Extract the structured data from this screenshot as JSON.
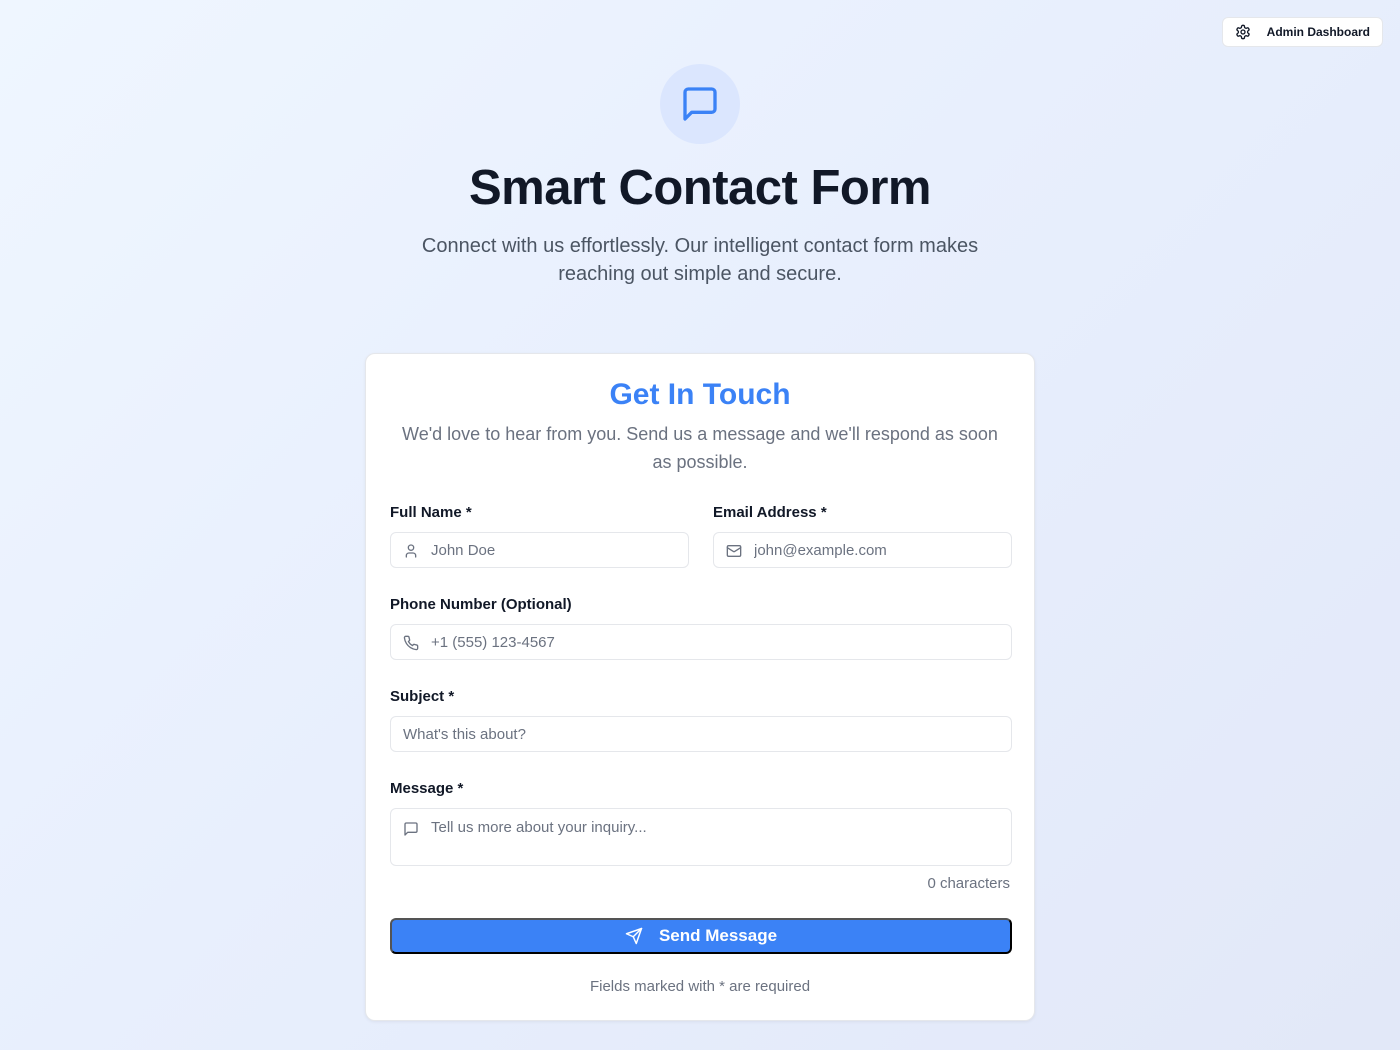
{
  "header": {
    "admin_button_label": "Admin Dashboard",
    "admin_icon": "gear-icon"
  },
  "hero": {
    "icon": "message-square-icon",
    "title": "Smart Contact Form",
    "subtitle": "Connect with us effortlessly. Our intelligent contact form makes reaching out simple and secure."
  },
  "form": {
    "title": "Get In Touch",
    "subtitle": "We'd love to hear from you. Send us a message and we'll respond as soon as possible.",
    "full_name": {
      "label": "Full Name *",
      "placeholder": "John Doe",
      "value": "",
      "icon": "user-icon"
    },
    "email": {
      "label": "Email Address *",
      "placeholder": "john@example.com",
      "value": "",
      "icon": "mail-icon"
    },
    "phone": {
      "label": "Phone Number (Optional)",
      "placeholder": "+1 (555) 123-4567",
      "value": "",
      "icon": "phone-icon"
    },
    "subject": {
      "label": "Subject *",
      "placeholder": "What's this about?",
      "value": ""
    },
    "message": {
      "label": "Message *",
      "placeholder": "Tell us more about your inquiry...",
      "value": "",
      "icon": "message-icon"
    },
    "char_count": "0 characters",
    "submit_label": "Send Message",
    "submit_icon": "send-icon",
    "required_note": "Fields marked with * are required"
  },
  "colors": {
    "accent": "#3b82f6",
    "hero_icon_bg": "#dbe6fe",
    "title": "#111827",
    "muted": "#6b7280"
  }
}
